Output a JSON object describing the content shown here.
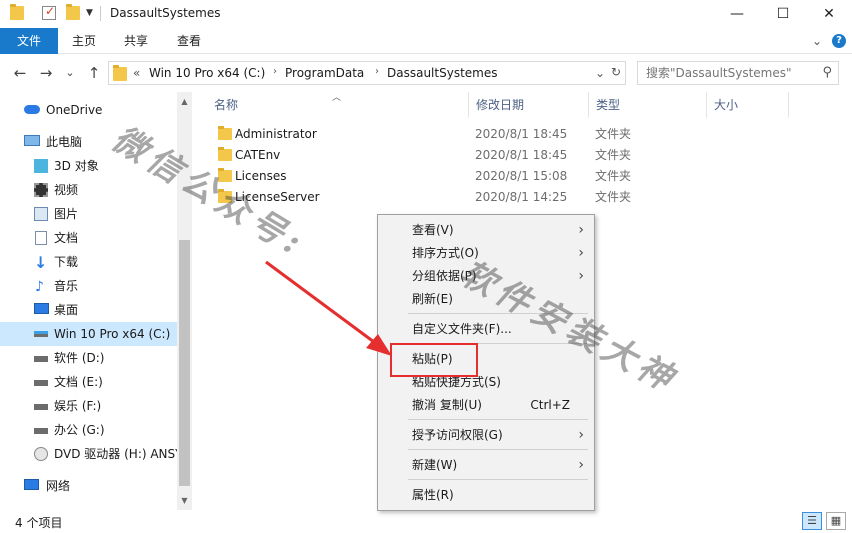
{
  "window": {
    "title": "DassaultSystemes",
    "minimize": "—",
    "maximize": "☐",
    "close": "✕"
  },
  "ribbon": {
    "tabs": [
      "文件",
      "主页",
      "共享",
      "查看"
    ],
    "chevron": "⌄",
    "help": "?"
  },
  "address": {
    "back": "←",
    "forward": "→",
    "recent": "⌄",
    "up": "↑",
    "overflow": "«",
    "crumbs": [
      "Win 10 Pro x64 (C:)",
      "ProgramData",
      "DassaultSystemes"
    ],
    "crumb_sep": "›",
    "dropdown": "⌄",
    "refresh": "↻"
  },
  "search": {
    "placeholder": "搜索\"DassaultSystemes\"",
    "icon": "search-icon"
  },
  "nav": {
    "items": [
      {
        "label": "OneDrive",
        "icon": "cloud-icon"
      },
      {
        "label": "此电脑",
        "icon": "computer-icon"
      },
      {
        "label": "3D 对象",
        "icon": "cube-icon"
      },
      {
        "label": "视频",
        "icon": "film-icon"
      },
      {
        "label": "图片",
        "icon": "picture-icon"
      },
      {
        "label": "文档",
        "icon": "document-icon"
      },
      {
        "label": "下载",
        "icon": "download-icon"
      },
      {
        "label": "音乐",
        "icon": "music-icon"
      },
      {
        "label": "桌面",
        "icon": "desktop-icon"
      },
      {
        "label": "Win 10 Pro x64 (C:)",
        "icon": "system-drive-icon"
      },
      {
        "label": "软件 (D:)",
        "icon": "drive-icon"
      },
      {
        "label": "文档 (E:)",
        "icon": "drive-icon"
      },
      {
        "label": "娱乐 (F:)",
        "icon": "drive-icon"
      },
      {
        "label": "办公 (G:)",
        "icon": "drive-icon"
      },
      {
        "label": "DVD 驱动器 (H:) ANSYS",
        "icon": "dvd-icon"
      },
      {
        "label": "网络",
        "icon": "network-icon"
      }
    ],
    "selected_index": 9
  },
  "columns": [
    "名称",
    "修改日期",
    "类型",
    "大小"
  ],
  "files": [
    {
      "name": "Administrator",
      "date": "2020/8/1 18:45",
      "type": "文件夹"
    },
    {
      "name": "CATEnv",
      "date": "2020/8/1 18:45",
      "type": "文件夹"
    },
    {
      "name": "Licenses",
      "date": "2020/8/1 15:08",
      "type": "文件夹"
    },
    {
      "name": "LicenseServer",
      "date": "2020/8/1 14:25",
      "type": "文件夹"
    }
  ],
  "context_menu": {
    "items": [
      {
        "label": "查看(V)",
        "submenu": true
      },
      {
        "label": "排序方式(O)",
        "submenu": true
      },
      {
        "label": "分组依据(P)",
        "submenu": true
      },
      {
        "label": "刷新(E)"
      },
      {
        "label": "自定义文件夹(F)..."
      },
      {
        "label": "粘贴(P)",
        "highlighted": true
      },
      {
        "label": "粘贴快捷方式(S)"
      },
      {
        "label": "撤消 复制(U)",
        "shortcut": "Ctrl+Z"
      },
      {
        "label": "授予访问权限(G)",
        "submenu": true
      },
      {
        "label": "新建(W)",
        "submenu": true
      },
      {
        "label": "属性(R)"
      }
    ],
    "submenu_glyph": "›"
  },
  "status": {
    "count": "4 个项目"
  },
  "watermark": {
    "part1": "微信公众号:",
    "part2": "软件安装大神"
  },
  "colors": {
    "accent": "#1979ca",
    "selection": "#cce8ff",
    "annotation": "#e52e2e"
  }
}
